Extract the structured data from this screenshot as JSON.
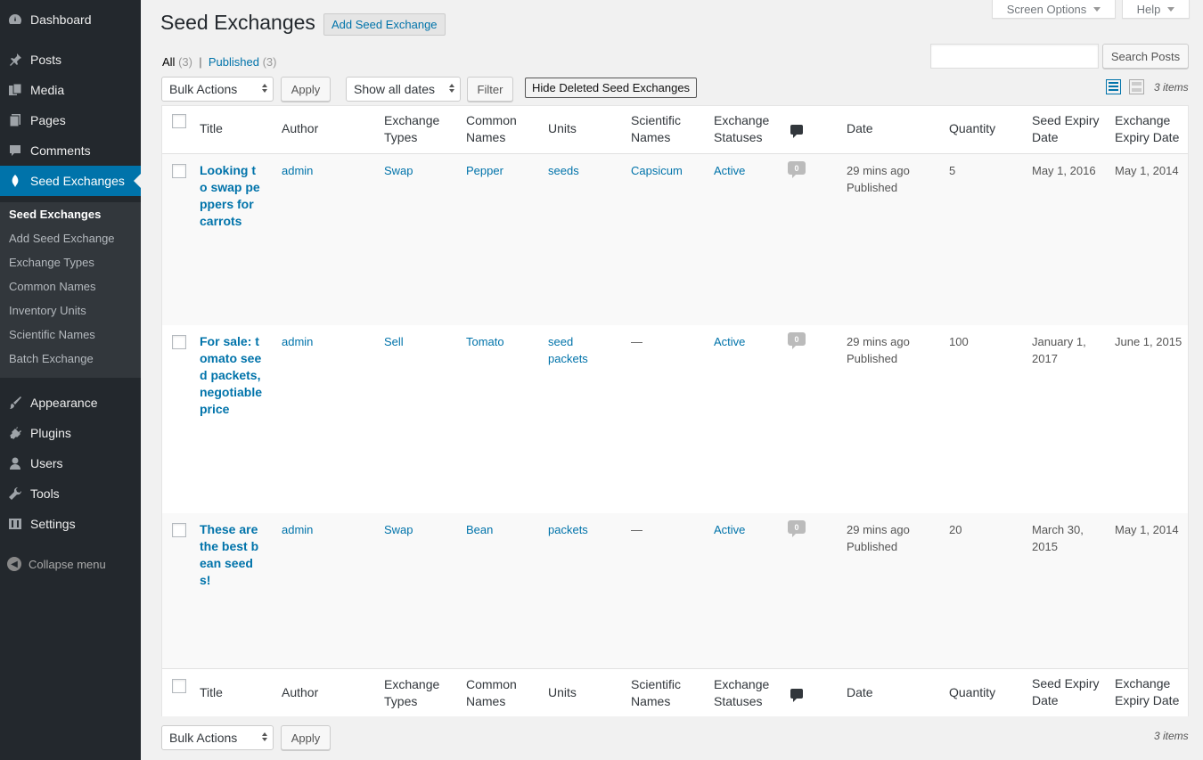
{
  "sidebar": {
    "menu": [
      {
        "label": "Dashboard",
        "icon": "dashboard-icon"
      },
      {
        "label": "Posts",
        "icon": "pin-icon"
      },
      {
        "label": "Media",
        "icon": "media-icon"
      },
      {
        "label": "Pages",
        "icon": "pages-icon"
      },
      {
        "label": "Comments",
        "icon": "comment-icon"
      },
      {
        "label": "Seed Exchanges",
        "icon": "seed-icon"
      },
      {
        "label": "Appearance",
        "icon": "brush-icon"
      },
      {
        "label": "Plugins",
        "icon": "plugin-icon"
      },
      {
        "label": "Users",
        "icon": "user-icon"
      },
      {
        "label": "Tools",
        "icon": "wrench-icon"
      },
      {
        "label": "Settings",
        "icon": "settings-icon"
      }
    ],
    "submenu": [
      "Seed Exchanges",
      "Add Seed Exchange",
      "Exchange Types",
      "Common Names",
      "Inventory Units",
      "Scientific Names",
      "Batch Exchange"
    ],
    "collapse": "Collapse menu"
  },
  "top_tabs": {
    "screen_options": "Screen Options",
    "help": "Help"
  },
  "header": {
    "title": "Seed Exchanges",
    "add_new": "Add Seed Exchange"
  },
  "views": {
    "all": "All",
    "all_count": "(3)",
    "sep": "|",
    "published": "Published",
    "published_count": "(3)"
  },
  "search": {
    "value": "",
    "button": "Search Posts"
  },
  "tablenav": {
    "bulk_actions": "Bulk Actions",
    "apply": "Apply",
    "dates": "Show all dates",
    "filter": "Filter",
    "hide_deleted": "Hide Deleted Seed Exchanges",
    "items": "3 items"
  },
  "columns": {
    "title": "Title",
    "author": "Author",
    "exchange_types": "Exchange Types",
    "common_names": "Common Names",
    "units": "Units",
    "scientific_names": "Scientific Names",
    "exchange_statuses": "Exchange Statuses",
    "date": "Date",
    "quantity": "Quantity",
    "seed_expiry": "Seed Expiry Date",
    "exchange_expiry": "Exchange Expiry Date"
  },
  "rows": [
    {
      "title": "Looking to swap peppers for carrots",
      "author": "admin",
      "type": "Swap",
      "common": "Pepper",
      "units": "seeds",
      "scientific": "Capsicum",
      "status": "Active",
      "comments": "0",
      "date": "29 mins ago",
      "date_status": "Published",
      "quantity": "5",
      "seed_expiry": "May 1, 2016",
      "exchange_expiry": "May 1, 2014"
    },
    {
      "title": "For sale: tomato seed packets, negotiable price",
      "author": "admin",
      "type": "Sell",
      "common": "Tomato",
      "units": "seed packets",
      "scientific": "—",
      "status": "Active",
      "comments": "0",
      "date": "29 mins ago",
      "date_status": "Published",
      "quantity": "100",
      "seed_expiry": "January 1, 2017",
      "exchange_expiry": "June 1, 2015"
    },
    {
      "title": "These are the best bean seeds!",
      "author": "admin",
      "type": "Swap",
      "common": "Bean",
      "units": "packets",
      "scientific": "—",
      "status": "Active",
      "comments": "0",
      "date": "29 mins ago",
      "date_status": "Published",
      "quantity": "20",
      "seed_expiry": "March 30, 2015",
      "exchange_expiry": "May 1, 2014"
    }
  ]
}
